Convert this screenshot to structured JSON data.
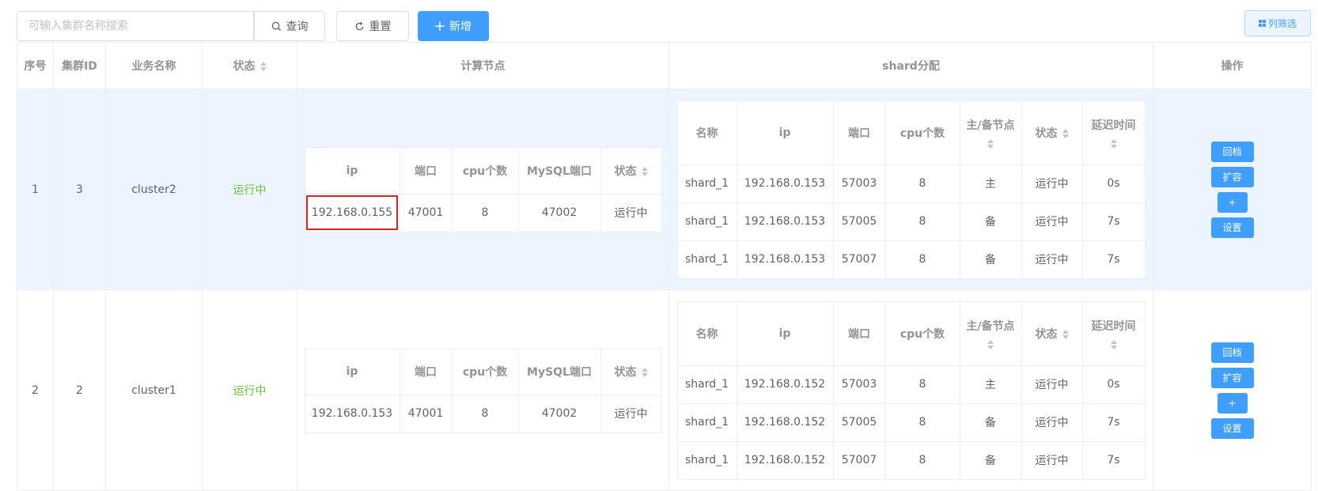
{
  "toolbar": {
    "search_placeholder": "可输入集群名称搜索",
    "query_label": "查询",
    "reset_label": "重置",
    "add_label": "新增",
    "filter_label": "列筛选"
  },
  "table": {
    "headers": {
      "index": "序号",
      "cluster_id": "集群ID",
      "business_name": "业务名称",
      "status": "状态",
      "compute_nodes": "计算节点",
      "shard": "shard分配",
      "ops": "操作"
    },
    "compute_headers": {
      "ip": "ip",
      "port": "端口",
      "cpu": "cpu个数",
      "mysql_port": "MySQL端口",
      "status": "状态"
    },
    "shard_headers": {
      "name": "名称",
      "ip": "ip",
      "port": "端口",
      "cpu": "cpu个数",
      "role": "主/备节点",
      "status": "状态",
      "delay": "延迟时间"
    },
    "op_labels": {
      "archive": "回档",
      "expand": "扩容",
      "plus": "+",
      "settings": "设置"
    },
    "rows": [
      {
        "index": "1",
        "cluster_id": "3",
        "name": "cluster2",
        "status": "运行中",
        "compute": {
          "ip": "192.168.0.155",
          "port": "47001",
          "cpu": "8",
          "mysql_port": "47002",
          "status": "运行中"
        },
        "shards": [
          {
            "name": "shard_1",
            "ip": "192.168.0.153",
            "port": "57003",
            "cpu": "8",
            "role": "主",
            "status": "运行中",
            "delay": "0s"
          },
          {
            "name": "shard_1",
            "ip": "192.168.0.153",
            "port": "57005",
            "cpu": "8",
            "role": "备",
            "status": "运行中",
            "delay": "7s"
          },
          {
            "name": "shard_1",
            "ip": "192.168.0.153",
            "port": "57007",
            "cpu": "8",
            "role": "备",
            "status": "运行中",
            "delay": "7s"
          }
        ]
      },
      {
        "index": "2",
        "cluster_id": "2",
        "name": "cluster1",
        "status": "运行中",
        "compute": {
          "ip": "192.168.0.153",
          "port": "47001",
          "cpu": "8",
          "mysql_port": "47002",
          "status": "运行中"
        },
        "shards": [
          {
            "name": "shard_1",
            "ip": "192.168.0.152",
            "port": "57003",
            "cpu": "8",
            "role": "主",
            "status": "运行中",
            "delay": "0s"
          },
          {
            "name": "shard_1",
            "ip": "192.168.0.152",
            "port": "57005",
            "cpu": "8",
            "role": "备",
            "status": "运行中",
            "delay": "7s"
          },
          {
            "name": "shard_1",
            "ip": "192.168.0.152",
            "port": "57007",
            "cpu": "8",
            "role": "备",
            "status": "运行中",
            "delay": "7s"
          }
        ]
      }
    ]
  },
  "colors": {
    "primary": "#409eff",
    "success": "#67c23a",
    "highlight": "#e02020",
    "row_highlight": "#ecf5ff"
  }
}
